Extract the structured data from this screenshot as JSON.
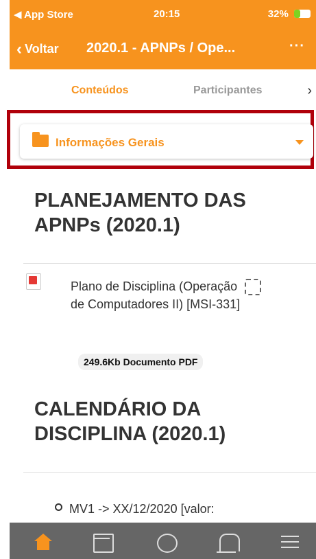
{
  "status_bar": {
    "carrier": "◀ App Store",
    "time": "20:15",
    "battery": "32%"
  },
  "nav": {
    "back_label": "Voltar",
    "title": "2020.1 - APNPs / Ope...",
    "more": "···"
  },
  "tabs": {
    "active": "Conteúdos",
    "inactive": "Participantes",
    "next": "›"
  },
  "section_selector": {
    "label": "Informações Gerais"
  },
  "content": {
    "heading1": "PLANEJAMENTO DAS APNPs (2020.1)",
    "file_name": "Plano de Disciplina (Operação de Computadores II) [MSI-331]",
    "file_meta": "249.6Kb Documento PDF",
    "heading2": "CALENDÁRIO DA DISCIPLINA (2020.1)",
    "list_item": "MV1 -> XX/12/2020 [valor:"
  },
  "colors": {
    "accent": "#f7931e",
    "frame": "#b0000a",
    "tabbar": "#666666"
  }
}
